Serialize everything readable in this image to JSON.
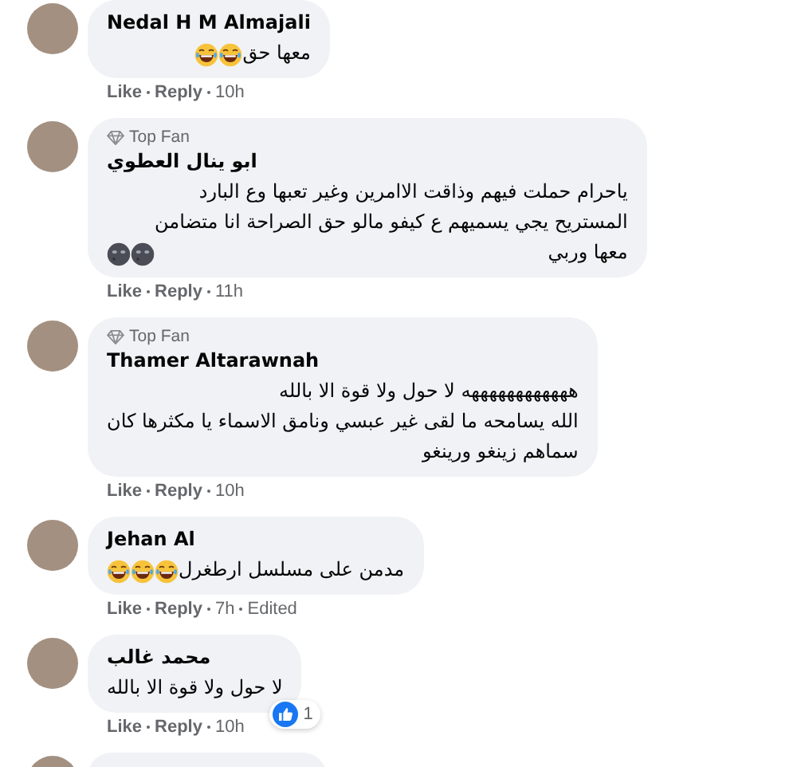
{
  "comments": [
    {
      "name": "Nedal H M Almajali",
      "top_fan": false,
      "text": "معها حق",
      "emojis": [
        {
          "kind": "laughing"
        },
        {
          "kind": "laughing"
        }
      ],
      "like": "Like",
      "reply": "Reply",
      "time": "10h"
    },
    {
      "name": "ابو ينال العطوي",
      "top_fan": true,
      "badge_label": "Top Fan",
      "text": "ياحرام حملت فيهم وذاقت الاامرين وغير تعبها وع البارد\nالمستريح يجي يسميهم ع كيفو مالو حق الصراحة انا متضامن\nمعها وربي",
      "emojis": [
        {
          "kind": "moon"
        },
        {
          "kind": "moon"
        }
      ],
      "like": "Like",
      "reply": "Reply",
      "time": "11h"
    },
    {
      "name": "Thamer Altarawnah",
      "top_fan": true,
      "badge_label": "Top Fan",
      "text": "ههههههههههههه لا حول ولا قوة الا بالله\nالله يسامحه ما لقى غير عبسي ونامق الاسماء يا مكثرها كان\nسماهم زينغو ورينغو",
      "like": "Like",
      "reply": "Reply",
      "time": "10h"
    },
    {
      "name": "Jehan Al",
      "top_fan": false,
      "text": "مدمن على مسلسل ارطغرل",
      "emojis": [
        {
          "kind": "laughing"
        },
        {
          "kind": "laughing"
        },
        {
          "kind": "laughing"
        }
      ],
      "like": "Like",
      "reply": "Reply",
      "time": "7h",
      "edited": "Edited"
    },
    {
      "name": "محمد غالب",
      "top_fan": false,
      "text": "لا حول ولا قوة الا بالله",
      "reaction_count": "1",
      "like": "Like",
      "reply": "Reply",
      "time": "10h"
    }
  ]
}
